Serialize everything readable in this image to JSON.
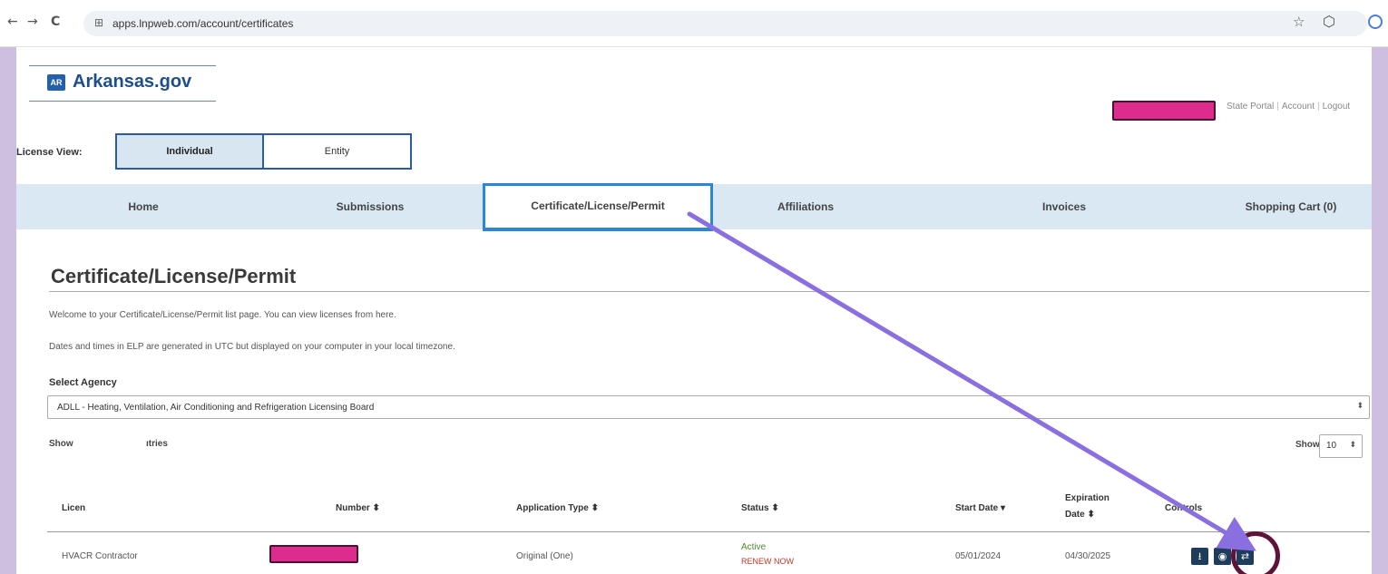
{
  "browser": {
    "back_glyph": "←",
    "forward_glyph": "→",
    "reload_glyph": "C",
    "site_info_glyph": "⊞",
    "url": "apps.lnpweb.com/account/certificates",
    "star_glyph": "☆",
    "extension_glyph": "⬡",
    "icons": [
      "back-icon",
      "forward-icon",
      "reload-icon",
      "site-info-icon",
      "star-icon",
      "extension-icon",
      "profile-icon"
    ]
  },
  "header": {
    "logo_badge": "AR",
    "logo_text": "Arkansas.gov",
    "links": [
      "State Portal",
      "Account",
      "Logout"
    ]
  },
  "license_view": {
    "label": "License View:",
    "options": [
      "Individual",
      "Entity"
    ],
    "selected": "Individual"
  },
  "nav": {
    "items": [
      "Home",
      "Submissions",
      "Certificate/License/Permit",
      "Affiliations",
      "Invoices",
      "Shopping Cart (0)"
    ],
    "active": "Certificate/License/Permit"
  },
  "main": {
    "title": "Certificate/License/Permit",
    "intro_1": "Welcome to your Certificate/License/Permit list page. You can view licenses from here.",
    "intro_2": "Dates and times in ELP are generated in UTC but displayed on your computer in your local timezone.",
    "agency_label": "Select Agency",
    "agency_value": "ADLL - Heating, Ventilation, Air Conditioning and Refrigeration Licensing Board",
    "select_arrow": "⬍",
    "show_entries_left": "Show",
    "show_entries_tail": "ıtries",
    "show_label": "Show",
    "show_value": "10"
  },
  "table": {
    "headers": [
      "Licen",
      "Number ⬍",
      "Application Type ⬍",
      "Status ⬍",
      "Start Date ▾",
      "Expiration",
      "Date ⬍",
      "Controls"
    ],
    "rows": [
      {
        "license": "HVACR Contractor",
        "application_type": "Original (One)",
        "status": "Active",
        "status_action": "RENEW NOW",
        "start_date": "05/01/2024",
        "expiration_date": "04/30/2025"
      }
    ],
    "control_icons": [
      "download-icon",
      "view-icon",
      "renew-icon"
    ],
    "control_glyphs": [
      "⭳",
      "◉",
      "⇄"
    ]
  },
  "colors": {
    "page_frame": "#cdbfe0",
    "nav_bg": "#d9e8f2",
    "active_tab_border": "#2b86d3",
    "redaction": "#de2c8e",
    "arrow": "#8a6fe0",
    "ring": "#5e1338",
    "control_bg": "#1e3c5c",
    "status_active": "#4f8a2e",
    "status_renew": "#c0392b"
  }
}
